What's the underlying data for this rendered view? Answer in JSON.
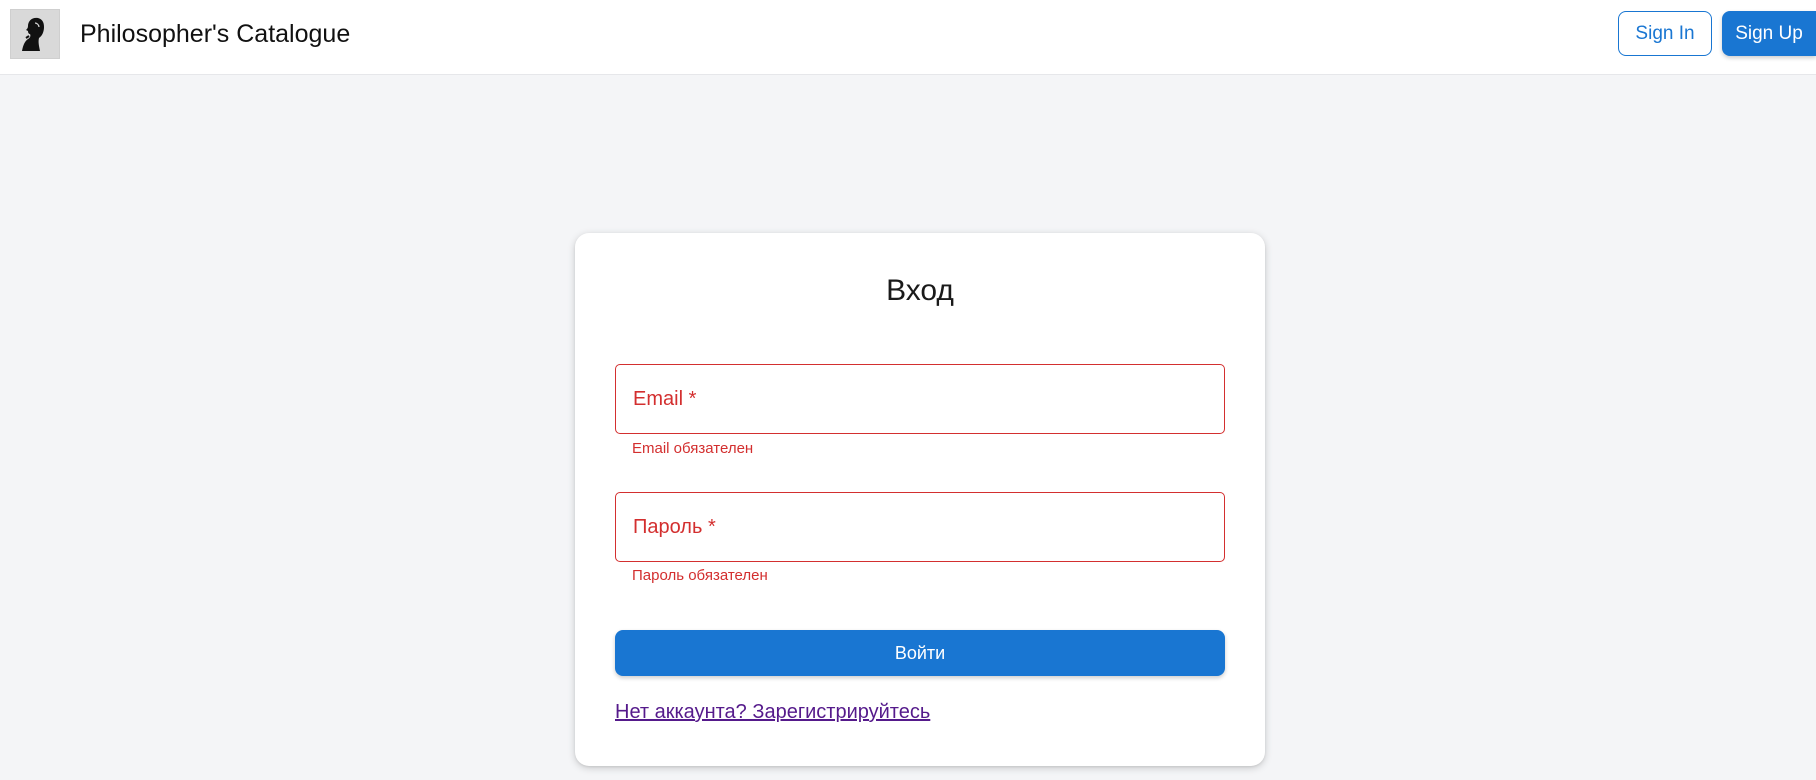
{
  "header": {
    "logo_icon": "philosopher-portrait-icon",
    "title": "Philosopher's Catalogue",
    "sign_in_label": "Sign In",
    "sign_up_label": "Sign Up"
  },
  "login": {
    "title": "Вход",
    "email": {
      "label": "Email *",
      "value": "",
      "error": "Email обязателен"
    },
    "password": {
      "label": "Пароль *",
      "value": "",
      "error": "Пароль обязателен"
    },
    "submit_label": "Войти",
    "register_link": "Нет аккаунта? Зарегистрируйтесь"
  },
  "colors": {
    "primary": "#1976d2",
    "error": "#d32f2f",
    "background": "#f4f5f7",
    "link_visited": "#551a8b"
  }
}
